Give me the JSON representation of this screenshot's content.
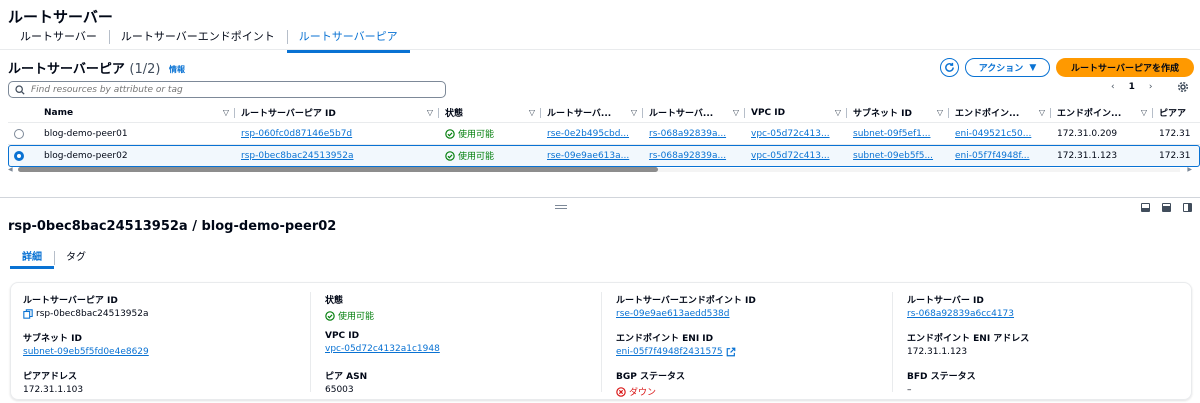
{
  "page": {
    "title": "ルートサーバー"
  },
  "tabs": [
    {
      "label": "ルートサーバー"
    },
    {
      "label": "ルートサーバーエンドポイント"
    },
    {
      "label": "ルートサーバーピア"
    }
  ],
  "list": {
    "title": "ルートサーバーピア",
    "count": "(1/2)",
    "info": "情報",
    "action_label": "アクション",
    "create_label": "ルートサーバーピアを作成",
    "search_placeholder": "Find resources by attribute or tag",
    "page_number": "1",
    "columns": [
      "Name",
      "ルートサーバーピア ID",
      "状態",
      "ルートサーバ...",
      "ルートサーバ...",
      "VPC ID",
      "サブネット ID",
      "エンドポイン...",
      "エンドポイン...",
      "ピアア"
    ],
    "rows": [
      {
        "name": "blog-demo-peer01",
        "peer_id": "rsp-060fc0d87146e5b7d",
        "state": "使用可能",
        "endpoint": "rse-0e2b495cbd...",
        "server": "rs-068a92839a...",
        "vpc": "vpc-05d72c413...",
        "subnet": "subnet-09f5ef1...",
        "eni": "eni-049521c50...",
        "eni_addr": "172.31.0.209",
        "peer_addr": "172.31"
      },
      {
        "name": "blog-demo-peer02",
        "peer_id": "rsp-0bec8bac24513952a",
        "state": "使用可能",
        "endpoint": "rse-09e9ae613a...",
        "server": "rs-068a92839a...",
        "vpc": "vpc-05d72c413...",
        "subnet": "subnet-09eb5f5...",
        "eni": "eni-05f7f4948f...",
        "eni_addr": "172.31.1.123",
        "peer_addr": "172.31"
      }
    ]
  },
  "detail": {
    "title": "rsp-0bec8bac24513952a / blog-demo-peer02",
    "tabs": [
      "詳細",
      "タグ"
    ],
    "fields": {
      "peer_id": {
        "label": "ルートサーバーピア ID",
        "value": "rsp-0bec8bac24513952a"
      },
      "state": {
        "label": "状態",
        "value": "使用可能"
      },
      "endpoint_id": {
        "label": "ルートサーバーエンドポイント ID",
        "value": "rse-09e9ae613aedd538d"
      },
      "server_id": {
        "label": "ルートサーバー ID",
        "value": "rs-068a92839a6cc4173"
      },
      "subnet_id": {
        "label": "サブネット ID",
        "value": "subnet-09eb5f5fd0e4e8629"
      },
      "vpc_id": {
        "label": "VPC ID",
        "value": "vpc-05d72c4132a1c1948"
      },
      "eni_id": {
        "label": "エンドポイント ENI ID",
        "value": "eni-05f7f4948f2431575"
      },
      "eni_addr": {
        "label": "エンドポイント ENI アドレス",
        "value": "172.31.1.123"
      },
      "peer_addr": {
        "label": "ピアアドレス",
        "value": "172.31.1.103"
      },
      "peer_asn": {
        "label": "ピア ASN",
        "value": "65003"
      },
      "bgp_status": {
        "label": "BGP ステータス",
        "value": "ダウン"
      },
      "bfd_status": {
        "label": "BFD ステータス",
        "value": "–"
      }
    }
  },
  "colors": {
    "accent": "#0972d3",
    "primary_button": "#ff9900",
    "success": "#037f0c",
    "error": "#d91515"
  }
}
